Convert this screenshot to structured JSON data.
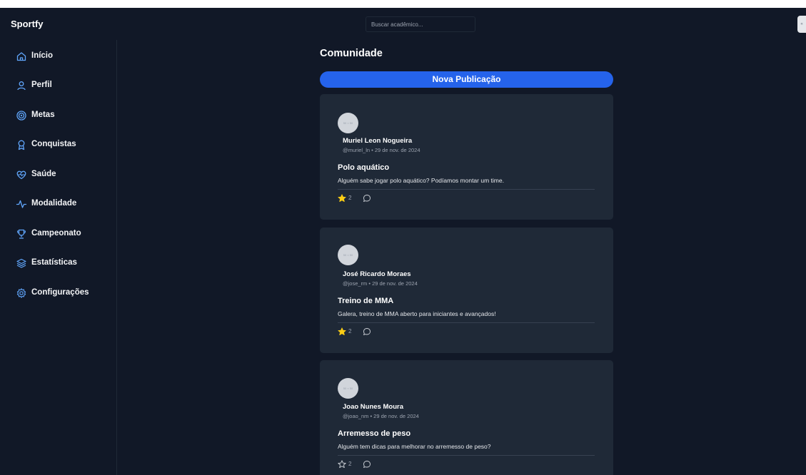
{
  "app": {
    "brand": "Sportfy"
  },
  "search": {
    "placeholder": "Buscar acadêmico..."
  },
  "edge_button": {
    "label": "«"
  },
  "sidebar": {
    "items": [
      {
        "label": "Início",
        "icon": "home-icon"
      },
      {
        "label": "Perfil",
        "icon": "user-icon"
      },
      {
        "label": "Metas",
        "icon": "target-icon"
      },
      {
        "label": "Conquistas",
        "icon": "award-icon"
      },
      {
        "label": "Saúde",
        "icon": "heart-pulse-icon"
      },
      {
        "label": "Modalidade",
        "icon": "activity-icon"
      },
      {
        "label": "Campeonato",
        "icon": "trophy-icon"
      },
      {
        "label": "Estatísticas",
        "icon": "layers-icon"
      },
      {
        "label": "Configurações",
        "icon": "gear-icon"
      }
    ]
  },
  "main": {
    "title": "Comunidade",
    "new_post_label": "Nova Publicação"
  },
  "posts": [
    {
      "avatar_text": "50 × 50",
      "author": "Muriel Leon Nogueira",
      "meta": "@muriel_ln • 29 de nov. de 2024",
      "title": "Polo aquático",
      "body": "Alguém sabe jogar polo aquático? Podíamos montar um time.",
      "likes": "2",
      "liked": true
    },
    {
      "avatar_text": "50 × 50",
      "author": "José Ricardo Moraes",
      "meta": "@jose_rm • 29 de nov. de 2024",
      "title": "Treino de MMA",
      "body": "Galera, treino de MMA aberto para iniciantes e avançados!",
      "likes": "2",
      "liked": true
    },
    {
      "avatar_text": "50 × 50",
      "author": "Joao Nunes Moura",
      "meta": "@joao_nm • 29 de nov. de 2024",
      "title": "Arremesso de peso",
      "body": "Alguém tem dicas para melhorar no arremesso de peso?",
      "likes": "2",
      "liked": false
    }
  ],
  "colors": {
    "background": "#111827",
    "card": "#1f2937",
    "accent": "#2563eb",
    "icon": "#60a5fa",
    "star": "#facc15"
  }
}
